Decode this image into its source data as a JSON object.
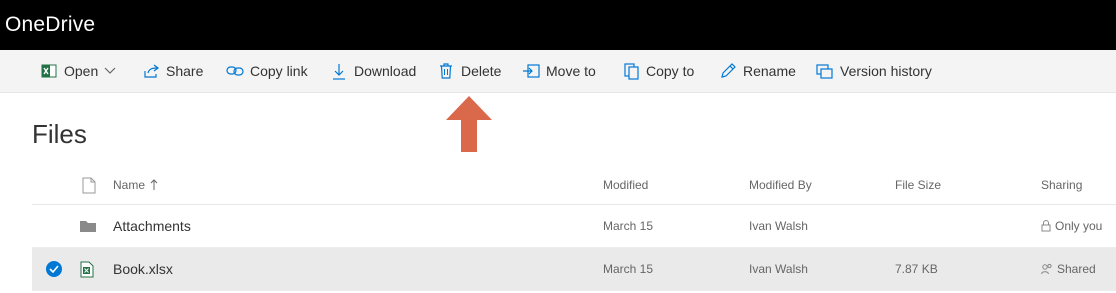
{
  "app": {
    "title": "OneDrive"
  },
  "toolbar": {
    "open_label": "Open",
    "share_label": "Share",
    "copy_link_label": "Copy link",
    "download_label": "Download",
    "delete_label": "Delete",
    "move_to_label": "Move to",
    "copy_to_label": "Copy to",
    "rename_label": "Rename",
    "version_history_label": "Version history"
  },
  "annotation": {
    "arrow_icon": "arrow-up-icon",
    "arrow_color": "#d9694a"
  },
  "page": {
    "title": "Files"
  },
  "table": {
    "columns": {
      "name": "Name",
      "modified": "Modified",
      "modified_by": "Modified By",
      "file_size": "File Size",
      "sharing": "Sharing"
    },
    "rows": [
      {
        "name": "Attachments",
        "modified": "March 15",
        "modified_by": "Ivan Walsh",
        "file_size": "",
        "sharing": "Only you",
        "icon": "folder-icon",
        "selected": false
      },
      {
        "name": "Book.xlsx",
        "modified": "March 15",
        "modified_by": "Ivan Walsh",
        "file_size": "7.87 KB",
        "sharing": "Shared",
        "icon": "excel-file-icon",
        "selected": true
      }
    ]
  },
  "colors": {
    "accent": "#0078d4",
    "excel": "#217346",
    "topbar": "#000000",
    "commandbar": "#f4f4f4"
  }
}
